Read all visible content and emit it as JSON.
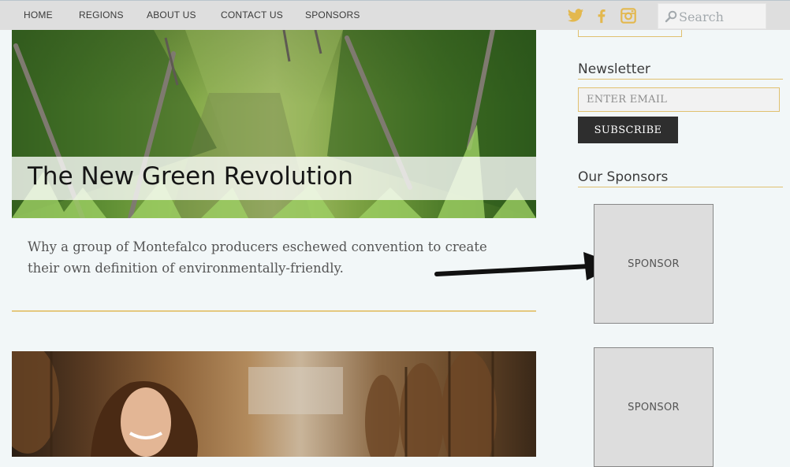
{
  "nav": {
    "items": [
      "HOME",
      "REGIONS",
      "ABOUT US",
      "CONTACT US",
      "SPONSORS"
    ]
  },
  "social": [
    "twitter-icon",
    "facebook-icon",
    "instagram-icon"
  ],
  "search": {
    "placeholder": "Search",
    "icon": "search-icon"
  },
  "articles": [
    {
      "title": "The New Green Revolution",
      "excerpt": "Why a group of Montefalco producers eschewed convention to create their own definition of environmentally-friendly."
    }
  ],
  "sidebar": {
    "newsletter": {
      "heading": "Newsletter",
      "email_placeholder": "ENTER EMAIL",
      "subscribe_label": "SUBSCRIBE"
    },
    "sponsors": {
      "heading": "Our Sponsors",
      "items": [
        "SPONSOR",
        "SPONSOR"
      ]
    }
  },
  "colors": {
    "accent_gold": "#e0c06f",
    "page_background": "#f2f7f8",
    "nav_background": "#dedede",
    "button_dark": "#2e2e2e"
  }
}
